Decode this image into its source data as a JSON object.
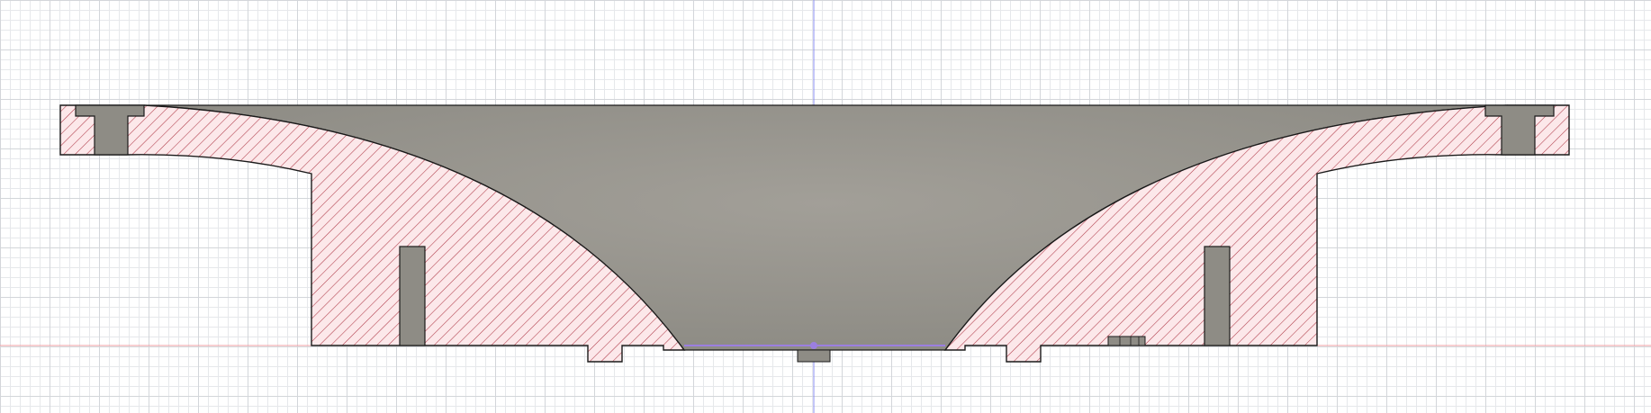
{
  "app": {
    "view": "section-analysis",
    "grid": "on"
  },
  "colors": {
    "background": "#ffffff",
    "grid_minor": "#e6e8eb",
    "grid_major": "#d3d6da",
    "axis_vertical": "#8a8cf0",
    "axis_horizontal": "#f0a0a6",
    "section_fill": "#fce8ea",
    "hatch": "#b03a48",
    "body_gray": "#9c9a94",
    "outline": "#1a1a1a",
    "selection": "#9b7fe0"
  }
}
